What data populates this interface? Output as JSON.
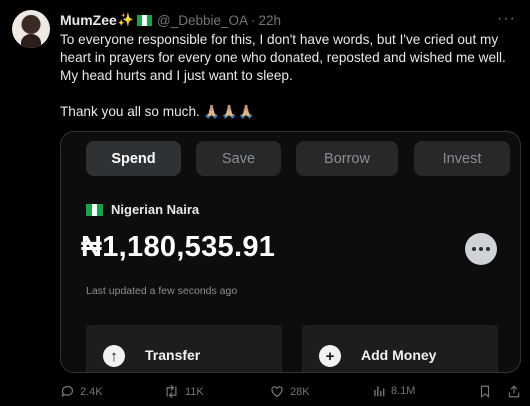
{
  "tweet": {
    "author_name": "MumZee",
    "author_emoji": "✨",
    "handle": "@_Debbie_OA",
    "separator": "·",
    "time": "22h",
    "more": "···",
    "text": "To everyone responsible for this, I don't have words, but I've cried out my heart in prayers for every one who donated, reposted and wished me well. My head hurts and I just want to sleep.",
    "thanks": "Thank you all so much.",
    "thanks_emoji": "🙏🏼🙏🏼🙏🏼"
  },
  "card": {
    "tabs": [
      {
        "label": "Spend"
      },
      {
        "label": "Save"
      },
      {
        "label": "Borrow"
      },
      {
        "label": "Invest"
      }
    ],
    "currency": "Nigerian Naira",
    "balance": "₦1,180,535.91",
    "last_updated": "Last updated a few seconds ago",
    "actions": [
      {
        "label": "Transfer",
        "icon": "arrow-up-icon",
        "glyph": "↑"
      },
      {
        "label": "Add Money",
        "icon": "plus-icon",
        "glyph": "+"
      }
    ]
  },
  "footer": {
    "replies": "2.4K",
    "reposts": "11K",
    "likes": "28K",
    "views": "8.1M"
  },
  "colors": {
    "background": "#000000",
    "text": "#e7e9ea",
    "muted": "#71767b",
    "card_bg": "#0d0d0d",
    "tab_bg": "#26282a",
    "nigeria_green": "#16a34a"
  }
}
